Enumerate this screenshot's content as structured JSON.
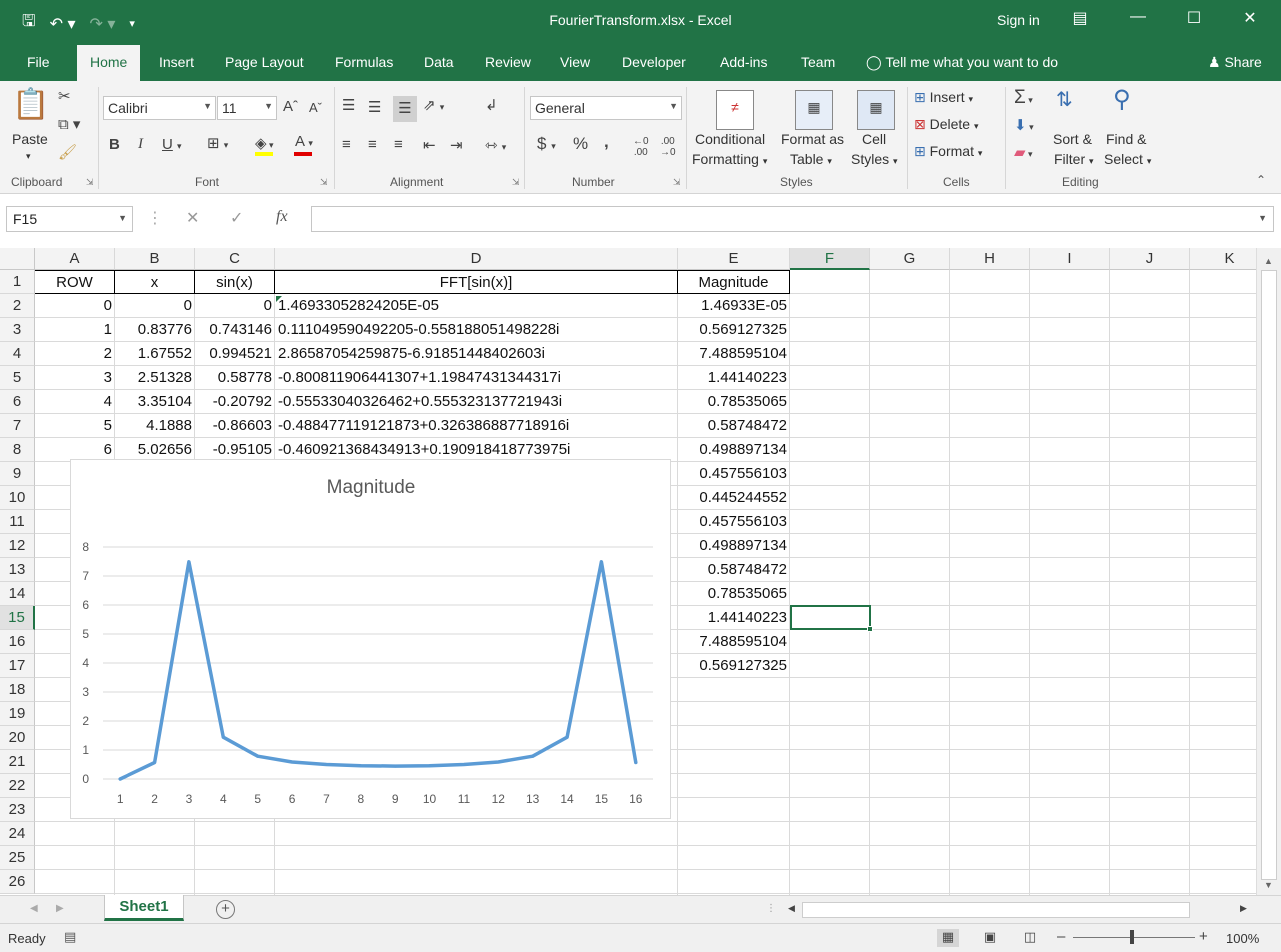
{
  "window": {
    "title": "FourierTransform.xlsx - Excel",
    "signin": "Sign in"
  },
  "qat": {
    "save_icon": "save-icon",
    "undo_icon": "undo-icon",
    "redo_icon": "redo-icon"
  },
  "tabs": [
    "File",
    "Home",
    "Insert",
    "Page Layout",
    "Formulas",
    "Data",
    "Review",
    "View",
    "Developer",
    "Add-ins",
    "Team"
  ],
  "tellme": "Tell me what you want to do",
  "share": "Share",
  "ribbon": {
    "clipboard": {
      "label": "Clipboard",
      "paste": "Paste"
    },
    "font": {
      "label": "Font",
      "name": "Calibri",
      "size": "11",
      "bold": "B",
      "italic": "I",
      "underline": "U"
    },
    "alignment": {
      "label": "Alignment"
    },
    "number": {
      "label": "Number",
      "format": "General",
      "currency": "$",
      "percent": "%",
      "comma": ","
    },
    "styles": {
      "label": "Styles",
      "cond1": "Conditional",
      "cond2": "Formatting",
      "fmt1": "Format as",
      "fmt2": "Table",
      "cell1": "Cell",
      "cell2": "Styles"
    },
    "cells": {
      "label": "Cells",
      "insert": "Insert",
      "delete": "Delete",
      "format": "Format"
    },
    "editing": {
      "label": "Editing",
      "sort1": "Sort &",
      "sort2": "Filter",
      "find1": "Find &",
      "find2": "Select"
    }
  },
  "formula_bar": {
    "name_box": "F15",
    "fx": "fx",
    "value": ""
  },
  "columns": [
    "A",
    "B",
    "C",
    "D",
    "E",
    "F",
    "G",
    "H",
    "I",
    "J",
    "K"
  ],
  "selected_column": "F",
  "rows": [
    "1",
    "2",
    "3",
    "4",
    "5",
    "6",
    "7",
    "8",
    "9",
    "10",
    "11",
    "12",
    "13",
    "14",
    "15",
    "16",
    "17",
    "18",
    "19",
    "20",
    "21",
    "22",
    "23",
    "24",
    "25",
    "26"
  ],
  "selected_row": "15",
  "headers": {
    "A": "ROW",
    "B": "x",
    "C": "sin(x)",
    "D": "FFT[sin(x)]",
    "E": "Magnitude"
  },
  "table": [
    [
      "0",
      "0",
      "0",
      "1.46933052824205E-05",
      "1.46933E-05"
    ],
    [
      "1",
      "0.83776",
      "0.743146",
      "0.111049590492205-0.558188051498228i",
      "0.569127325"
    ],
    [
      "2",
      "1.67552",
      "0.994521",
      "2.86587054259875-6.91851448402603i",
      "7.488595104"
    ],
    [
      "3",
      "2.51328",
      "0.58778",
      "-0.800811906441307+1.19847431344317i",
      "1.44140223"
    ],
    [
      "4",
      "3.35104",
      "-0.20792",
      "-0.55533040326462+0.555323137721943i",
      "0.78535065"
    ],
    [
      "5",
      "4.1888",
      "-0.86603",
      "-0.488477119121873+0.326386887718916i",
      "0.58748472"
    ],
    [
      "6",
      "5.02656",
      "-0.95105",
      "-0.460921368434913+0.190918418773975i",
      "0.498897134"
    ]
  ],
  "magnitude_rest": [
    "0.457556103",
    "0.445244552",
    "0.457556103",
    "0.498897134",
    "0.58748472",
    "0.78535065",
    "1.44140223",
    "7.488595104",
    "0.569127325"
  ],
  "chart_data": {
    "type": "line",
    "title": "Magnitude",
    "x": [
      "1",
      "2",
      "3",
      "4",
      "5",
      "6",
      "7",
      "8",
      "9",
      "10",
      "11",
      "12",
      "13",
      "14",
      "15",
      "16"
    ],
    "series": [
      {
        "values": [
          1.47e-05,
          0.569127325,
          7.488595104,
          1.44140223,
          0.78535065,
          0.58748472,
          0.498897134,
          0.457556103,
          0.445244552,
          0.457556103,
          0.498897134,
          0.58748472,
          0.78535065,
          1.44140223,
          7.488595104,
          0.569127325
        ]
      }
    ],
    "y_ticks": [
      "0",
      "1",
      "2",
      "3",
      "4",
      "5",
      "6",
      "7",
      "8"
    ],
    "ylim": [
      0,
      8
    ],
    "grid": true,
    "color": "#5b9bd5"
  },
  "sheet_tab": "Sheet1",
  "status": {
    "ready": "Ready",
    "zoom": "100%"
  }
}
